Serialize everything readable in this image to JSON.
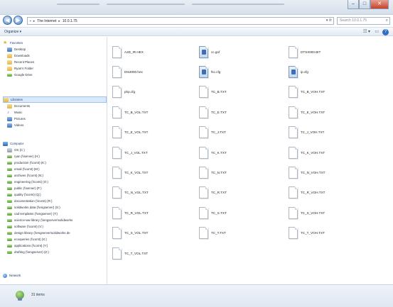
{
  "address": {
    "breadcrumbs": [
      "The Internet",
      "10.0.1.75"
    ],
    "search_placeholder": "Search 10.0.1.75"
  },
  "toolbar": {
    "organize_label": "Organize ▾"
  },
  "sidebar": {
    "favorites": [
      "Favorites",
      "Desktop",
      "Downloads",
      "Recent Places",
      "Ryan's Folder",
      "Google Drive"
    ],
    "libraries": [
      "Libraries",
      "Documents",
      "Music",
      "Pictures",
      "Videos"
    ],
    "computer": [
      "Computer",
      "OS (C:)",
      "ryan (\\\\server) (H:)",
      "production (\\\\comt) (K:)",
      "email (\\\\comt) (M:)",
      "archives (\\\\comt) (N:)",
      "engineering (\\\\comt) (O:)",
      "public (\\\\server) (P:)",
      "quality (\\\\comt) (Q:)",
      "documentation (\\\\comt) (R:)",
      "solidworks data (\\\\engserver) (S:)",
      "cad templates (\\\\engserver) (T:)",
      "science-ww library (\\\\engserver\\solidworks",
      "software (\\\\comt) (V:)",
      "design library (\\\\engserver\\solidworks de",
      "ecoqueries (\\\\comt) (X:)",
      "applications (\\\\comt) (Y:)",
      "drafting (\\\\engserver) (Z:)"
    ],
    "network": "Network"
  },
  "files": [
    {
      "name": "A2D_IR.HEX",
      "kind": "doc"
    },
    {
      "name": "cc.gof",
      "kind": "app"
    },
    {
      "name": "DTSX000.BIT",
      "kind": "doc"
    },
    {
      "name": "Dts3000.hex",
      "kind": "doc"
    },
    {
      "name": "fsc.cfg",
      "kind": "app"
    },
    {
      "name": "ip.cfg",
      "kind": "app"
    },
    {
      "name": "php.cfg",
      "kind": "doc"
    },
    {
      "name": "TC_B.TXT",
      "kind": "doc"
    },
    {
      "name": "TC_B_VOH.TXT",
      "kind": "doc"
    },
    {
      "name": "TC_B_VOL.TXT",
      "kind": "doc"
    },
    {
      "name": "TC_E.TXT",
      "kind": "doc"
    },
    {
      "name": "TC_E_VOH.TXT",
      "kind": "doc"
    },
    {
      "name": "TC_E_VOL.TXT",
      "kind": "doc"
    },
    {
      "name": "TC_J.TXT",
      "kind": "doc"
    },
    {
      "name": "TC_J_VOH.TXT",
      "kind": "doc"
    },
    {
      "name": "TC_J_VOL.TXT",
      "kind": "doc"
    },
    {
      "name": "TC_K.TXT",
      "kind": "doc"
    },
    {
      "name": "TC_K_VOH.TXT",
      "kind": "doc"
    },
    {
      "name": "TC_K_VOL.TXT",
      "kind": "doc"
    },
    {
      "name": "TC_N.TXT",
      "kind": "doc"
    },
    {
      "name": "TC_N_VOH.TXT",
      "kind": "doc"
    },
    {
      "name": "TC_N_VOL.TXT",
      "kind": "doc"
    },
    {
      "name": "TC_R.TXT",
      "kind": "doc"
    },
    {
      "name": "TC_R_VOH.TXT",
      "kind": "doc"
    },
    {
      "name": "TC_R_VOL.TXT",
      "kind": "doc"
    },
    {
      "name": "TC_S.TXT",
      "kind": "doc"
    },
    {
      "name": "TC_S_VOH.TXT",
      "kind": "doc"
    },
    {
      "name": "TC_S_VOL.TXT",
      "kind": "doc"
    },
    {
      "name": "TC_T.TXT",
      "kind": "doc"
    },
    {
      "name": "TC_T_VOH.TXT",
      "kind": "doc"
    },
    {
      "name": "TC_T_VOL.TXT",
      "kind": "doc"
    }
  ],
  "status": {
    "item_count": "31 items"
  }
}
